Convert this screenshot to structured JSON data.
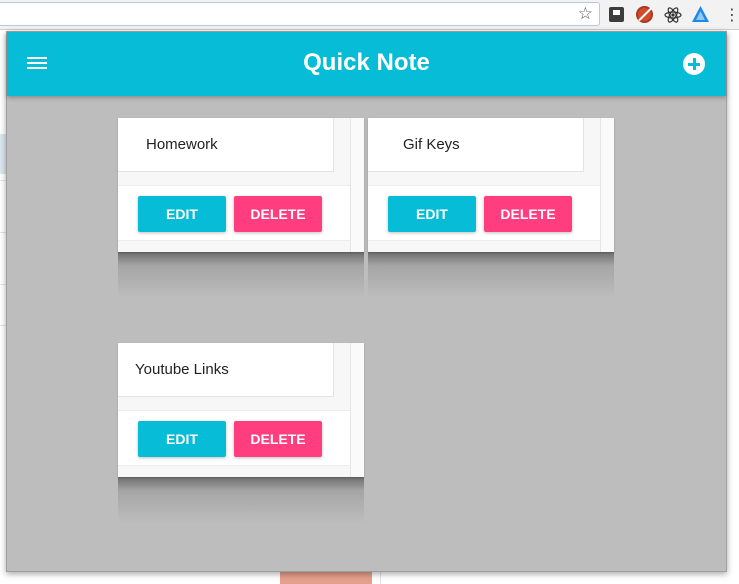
{
  "app": {
    "title": "Quick Note",
    "accent_color": "#07bcd6",
    "delete_color": "#ff3d7f",
    "background_color": "#bdbdbd"
  },
  "toolbar": {
    "menu_icon": "hamburger-menu-icon",
    "add_icon": "plus-circle-icon"
  },
  "browser": {
    "bookmark_icon": "star-icon",
    "star_glyph": "☆",
    "menu_glyph": "⋮",
    "extensions": [
      "stop-extension-icon",
      "block-extension-icon",
      "react-extension-icon",
      "quick-note-extension-icon"
    ]
  },
  "notes": [
    {
      "title": "Homework",
      "edit_label": "EDIT",
      "delete_label": "DELETE"
    },
    {
      "title": "Gif Keys",
      "edit_label": "EDIT",
      "delete_label": "DELETE"
    },
    {
      "title": "Youtube Links",
      "edit_label": "EDIT",
      "delete_label": "DELETE"
    }
  ]
}
